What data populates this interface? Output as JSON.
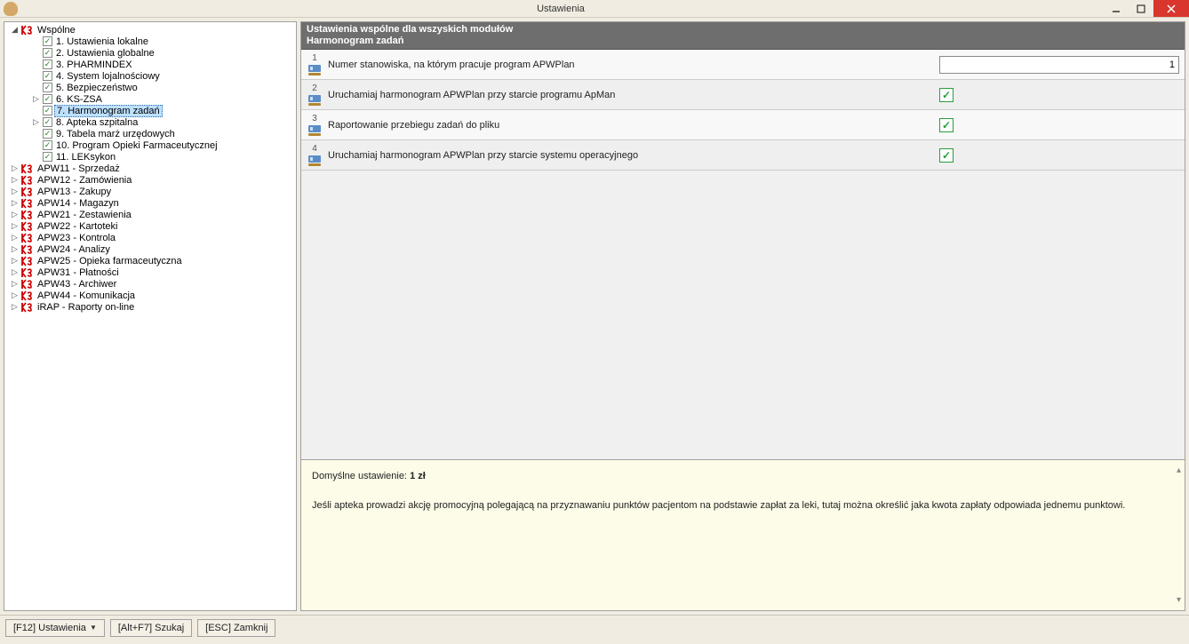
{
  "window": {
    "title": "Ustawienia"
  },
  "tree": {
    "root": {
      "label": "Wspólne"
    },
    "children": [
      {
        "label": "1. Ustawienia lokalne"
      },
      {
        "label": "2. Ustawienia globalne"
      },
      {
        "label": "3. PHARMINDEX"
      },
      {
        "label": "4. System lojalnościowy"
      },
      {
        "label": "5. Bezpieczeństwo"
      },
      {
        "label": "6. KS-ZSA"
      },
      {
        "label": "7. Harmonogram zadań"
      },
      {
        "label": "8. Apteka szpitalna"
      },
      {
        "label": "9. Tabela marż urzędowych"
      },
      {
        "label": "10. Program Opieki Farmaceutycznej"
      },
      {
        "label": "11. LEKsykon"
      }
    ],
    "modules": [
      {
        "label": "APW11 - Sprzedaż"
      },
      {
        "label": "APW12 - Zamówienia"
      },
      {
        "label": "APW13 - Zakupy"
      },
      {
        "label": "APW14 - Magazyn"
      },
      {
        "label": "APW21 - Zestawienia"
      },
      {
        "label": "APW22 - Kartoteki"
      },
      {
        "label": "APW23 - Kontrola"
      },
      {
        "label": "APW24 - Analizy"
      },
      {
        "label": "APW25 - Opieka farmaceutyczna"
      },
      {
        "label": "APW31 - Płatności"
      },
      {
        "label": "APW43 - Archiwer"
      },
      {
        "label": "APW44 - Komunikacja"
      },
      {
        "label": "iRAP - Raporty on-line"
      }
    ]
  },
  "settings": {
    "header1": "Ustawienia wspólne dla wszyskich modułów",
    "header2": "Harmonogram zadań",
    "rows": [
      {
        "num": "1",
        "label": "Numer stanowiska, na którym pracuje program APWPlan",
        "type": "text",
        "value": "1"
      },
      {
        "num": "2",
        "label": "Uruchamiaj harmonogram APWPlan przy starcie programu ApMan",
        "type": "check",
        "checked": true
      },
      {
        "num": "3",
        "label": "Raportowanie przebiegu zadań do pliku",
        "type": "check",
        "checked": true
      },
      {
        "num": "4",
        "label": "Uruchamiaj harmonogram APWPlan przy starcie systemu operacyjnego",
        "type": "check",
        "checked": true
      }
    ]
  },
  "info": {
    "defaultLabel": "Domyślne ustawienie:",
    "defaultValue": "1 zł",
    "body": "Jeśli apteka prowadzi akcję promocyjną polegającą na przyznawaniu punktów pacjentom na podstawie zapłat za leki, tutaj można określić jaka kwota zapłaty odpowiada jednemu punktowi."
  },
  "footer": {
    "settings": "[F12] Ustawienia",
    "search": "[Alt+F7] Szukaj",
    "close": "[ESC] Zamknij"
  }
}
